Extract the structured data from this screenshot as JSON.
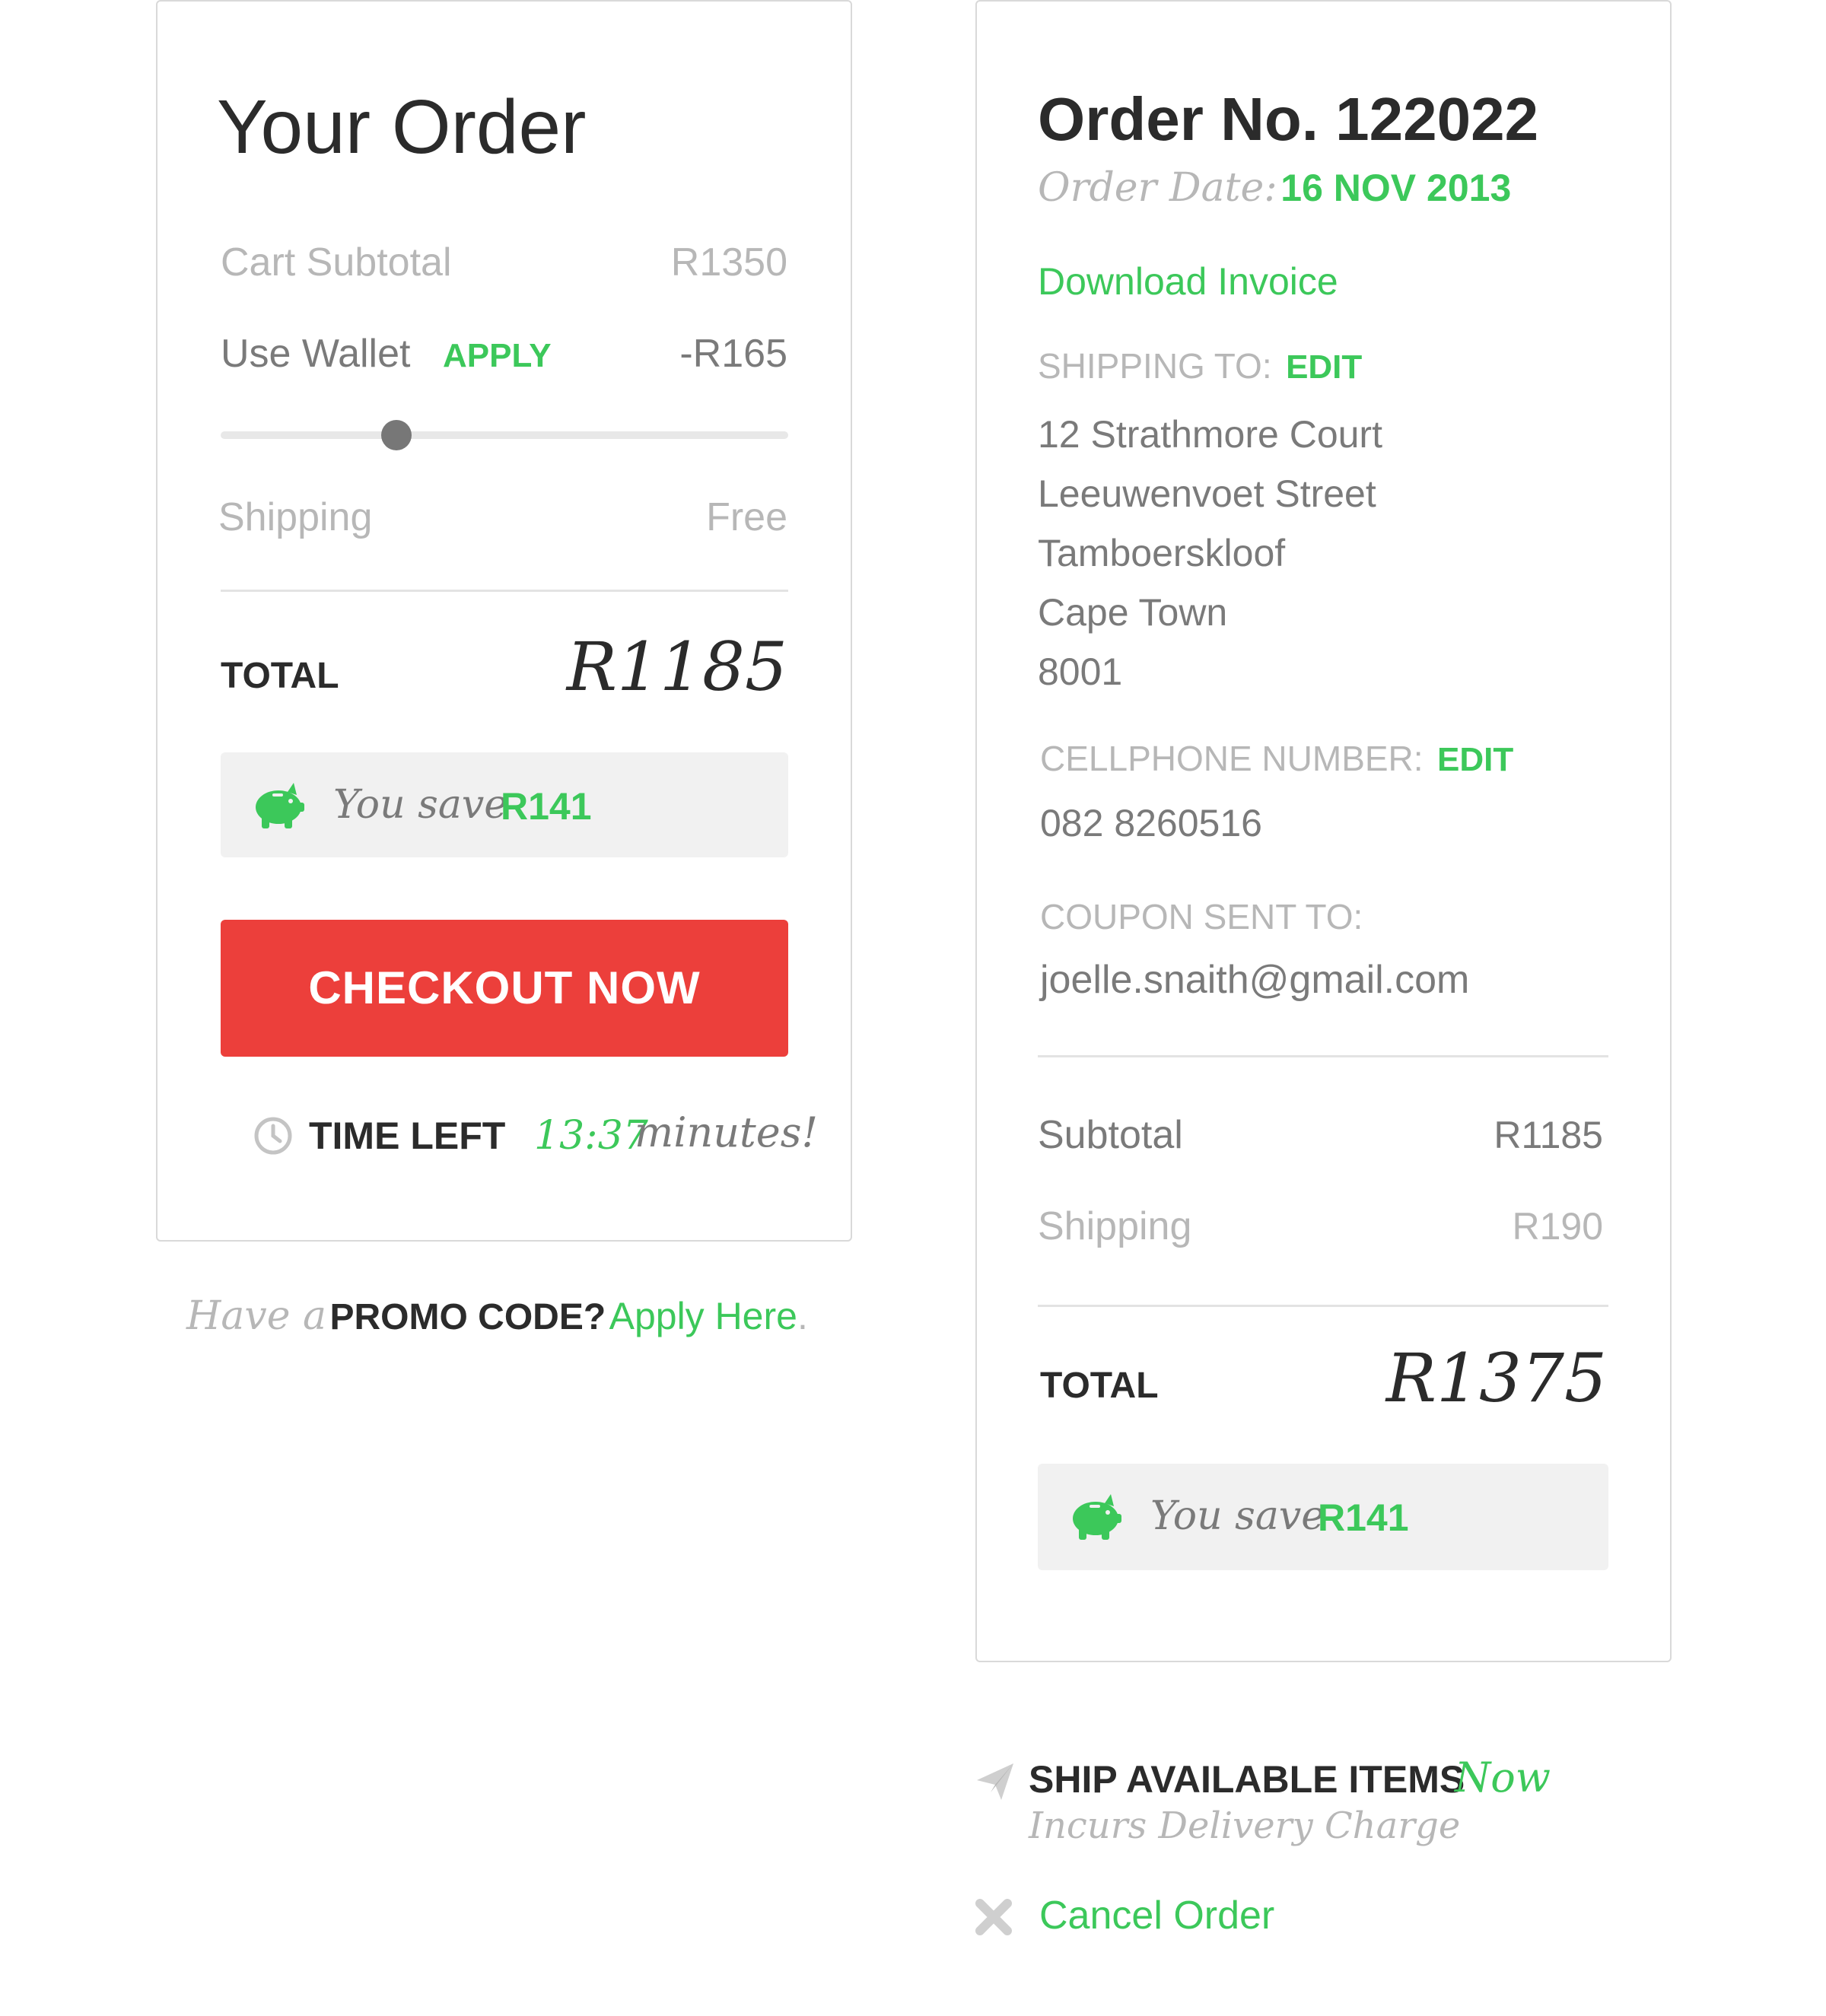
{
  "your_order": {
    "title": "Your Order",
    "cart_subtotal_label": "Cart Subtotal",
    "cart_subtotal_value": "R1350",
    "wallet_label": "Use Wallet",
    "wallet_apply": "APPLY",
    "wallet_value": "-R165",
    "wallet_slider_fraction": 0.31,
    "shipping_label": "Shipping",
    "shipping_value": "Free",
    "total_label": "TOTAL",
    "total_value": "R1185",
    "save_prefix": "You save",
    "save_value": "R141",
    "checkout_label": "CHECKOUT NOW",
    "time_left_label": "TIME LEFT",
    "time_left_value": "13:37",
    "time_left_suffix": "minutes!"
  },
  "promo": {
    "prefix": "Have a",
    "code_label": "PROMO CODE?",
    "link": "Apply Here",
    "period": "."
  },
  "order_detail": {
    "title": "Order No. 122022",
    "date_label": "Order Date:",
    "date_value": "16 NOV 2013",
    "download_invoice": "Download Invoice",
    "shipping_to_label": "SHIPPING TO:",
    "shipping_edit": "EDIT",
    "address": [
      "12 Strathmore Court",
      "Leeuwenvoet Street",
      "Tamboerskloof",
      "Cape Town",
      "8001"
    ],
    "cellphone_label": "CELLPHONE NUMBER:",
    "cellphone_edit": "EDIT",
    "cellphone_value": "082 8260516",
    "coupon_label": "COUPON SENT TO:",
    "coupon_value": "joelle.snaith@gmail.com",
    "subtotal_label": "Subtotal",
    "subtotal_value": "R1185",
    "shipping_label": "Shipping",
    "shipping_value": "R190",
    "total_label": "TOTAL",
    "total_value": "R1375",
    "save_prefix": "You save",
    "save_value": "R141"
  },
  "actions": {
    "ship_label": "SHIP AVAILABLE ITEMS",
    "ship_now": "Now",
    "ship_note": "Incurs Delivery Charge",
    "cancel_label": "Cancel Order"
  },
  "colors": {
    "accent_green": "#3cc85a",
    "checkout_red": "#ec3f3b",
    "muted_gray": "#b7b7b7",
    "text_dark": "#2b2b2b"
  },
  "icons": [
    "piggy-bank-icon",
    "clock-icon",
    "paper-plane-icon",
    "close-icon"
  ]
}
